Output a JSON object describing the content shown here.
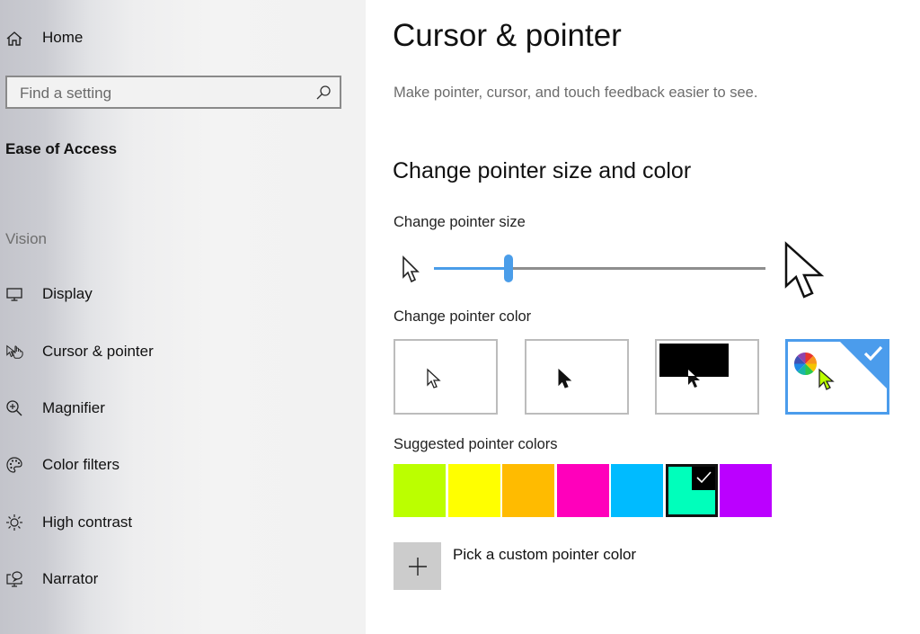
{
  "sidebar": {
    "home_label": "Home",
    "search": {
      "placeholder": "Find a setting",
      "value": ""
    },
    "section_title": "Ease of Access",
    "group_label": "Vision",
    "items": [
      {
        "label": "Display",
        "icon": "display-icon"
      },
      {
        "label": "Cursor & pointer",
        "icon": "cursor-pointer-icon",
        "selected": true
      },
      {
        "label": "Magnifier",
        "icon": "magnifier-icon"
      },
      {
        "label": "Color filters",
        "icon": "palette-icon"
      },
      {
        "label": "High contrast",
        "icon": "high-contrast-icon"
      },
      {
        "label": "Narrator",
        "icon": "narrator-icon"
      }
    ]
  },
  "main": {
    "title": "Cursor & pointer",
    "description": "Make pointer, cursor, and touch feedback easier to see.",
    "section_title": "Change pointer size and color",
    "pointer_size": {
      "label": "Change pointer size",
      "value_fraction": 0.225
    },
    "pointer_color": {
      "label": "Change pointer color",
      "options": [
        {
          "name": "white",
          "selected": false
        },
        {
          "name": "black",
          "selected": false
        },
        {
          "name": "inverted",
          "selected": false
        },
        {
          "name": "custom",
          "selected": true
        }
      ],
      "accent_color": "#4b9cec"
    },
    "suggested_colors": {
      "label": "Suggested pointer colors",
      "colors": [
        "#bbff00",
        "#ffff00",
        "#ffbb00",
        "#ff00bb",
        "#00bbff",
        "#00ffbb",
        "#bb00ff"
      ],
      "selected_index": 5
    },
    "custom_color": {
      "label": "Pick a custom pointer color"
    },
    "selected_pointer_color": "#bbff00"
  }
}
